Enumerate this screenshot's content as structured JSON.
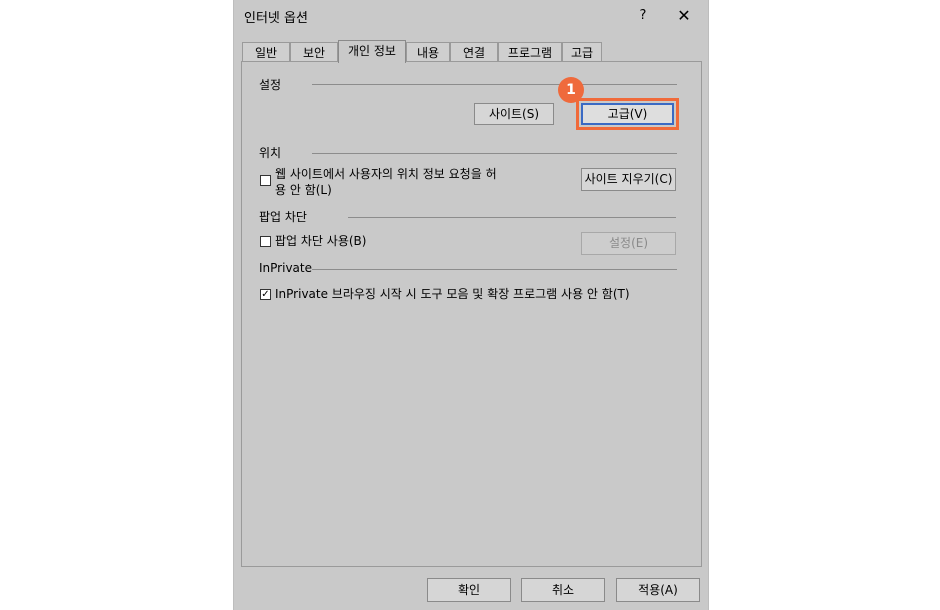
{
  "window": {
    "title": "인터넷 옵션",
    "help": "?",
    "close": "✕"
  },
  "tabs": [
    {
      "label": "일반"
    },
    {
      "label": "보안"
    },
    {
      "label": "개인 정보"
    },
    {
      "label": "내용"
    },
    {
      "label": "연결"
    },
    {
      "label": "프로그램"
    },
    {
      "label": "고급"
    }
  ],
  "active_tab": "개인 정보",
  "settings": {
    "heading": "설정",
    "sites_button": "사이트(S)",
    "advanced_button": "고급(V)",
    "callout_number": "1"
  },
  "location": {
    "heading": "위치",
    "checkbox_line1": "웹 사이트에서 사용자의 위치 정보 요청을 허",
    "checkbox_line2": "용 안 함(L)",
    "checked": false,
    "clear_sites_button": "사이트 지우기(C)"
  },
  "popup": {
    "heading": "팝업 차단",
    "checkbox_label": "팝업 차단 사용(B)",
    "checked": false,
    "settings_button": "설정(E)"
  },
  "inprivate": {
    "heading": "InPrivate",
    "checkbox_label": "InPrivate 브라우징 시작 시 도구 모음 및 확장 프로그램 사용 안 함(T)",
    "checked": true,
    "check_glyph": "✓"
  },
  "footer": {
    "ok": "확인",
    "cancel": "취소",
    "apply": "적용(A)"
  },
  "colors": {
    "highlight": "#f06a3a",
    "dialog_bg": "#c9c9c9",
    "default_button_border": "#3a6ac4"
  }
}
